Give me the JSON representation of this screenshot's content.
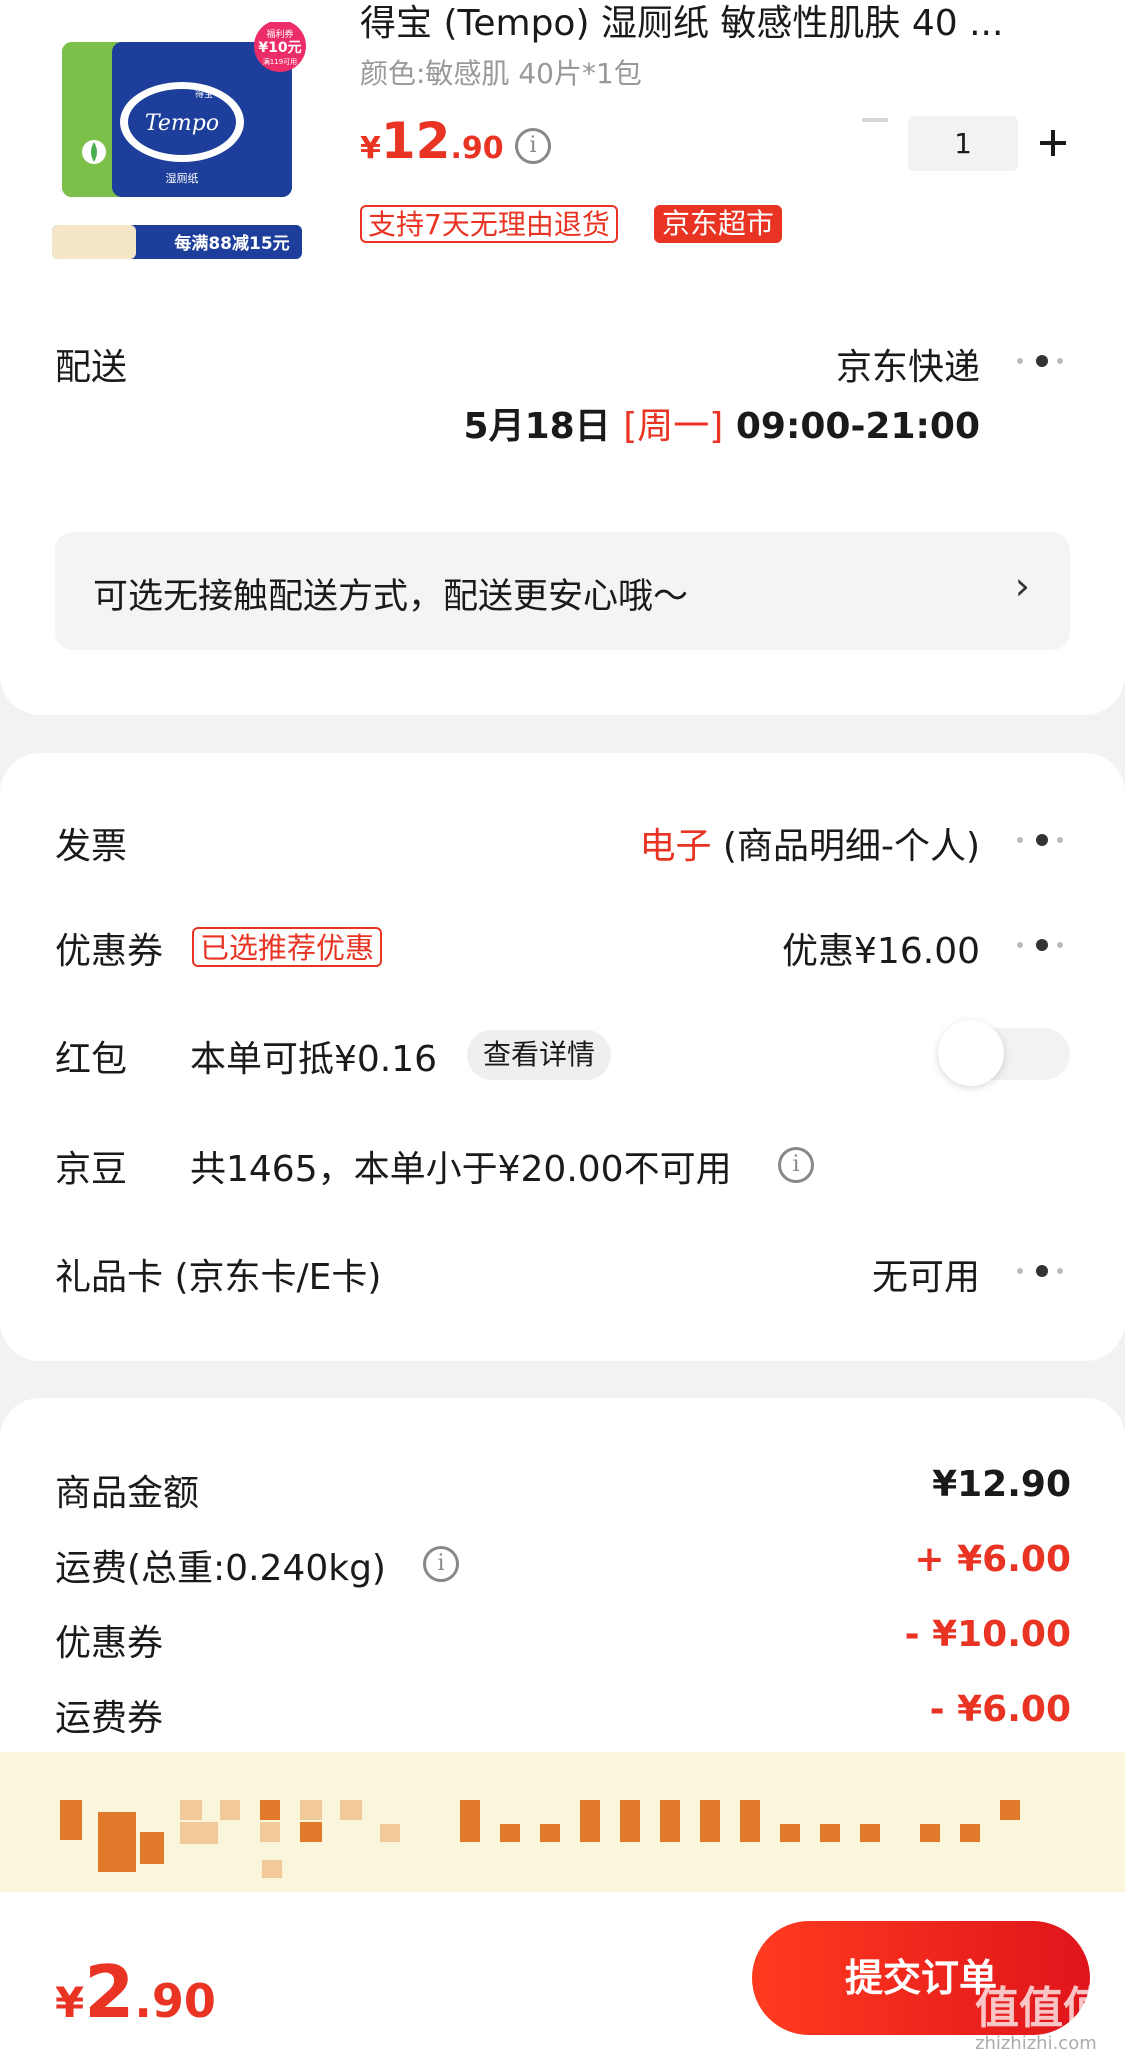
{
  "product": {
    "title": "得宝 (Tempo) 湿厕纸 敏感性肌肤 40 ...",
    "spec": "颜色:敏感肌 40片*1包",
    "price_currency": "¥",
    "price_int": "12",
    "price_dec": ".90",
    "quantity": "1",
    "tag_return": "支持7天无理由退货",
    "tag_store": "京东超市",
    "img_brand": "Tempo",
    "img_brand_cn": "得宝",
    "img_name": "湿厕纸",
    "img_coupon_top": "福利券",
    "img_coupon_amount": "¥10元",
    "img_coupon_cond": "满119可用",
    "img_promo": "每满88减15元"
  },
  "delivery": {
    "label": "配送",
    "method": "京东快递",
    "date": "5月18日",
    "weekday": "[周一]",
    "time": "09:00-21:00",
    "banner": "可选无接触配送方式，配送更安心哦～",
    "banner_chevron": "›"
  },
  "invoice": {
    "label": "发票",
    "type": "电子",
    "detail": "(商品明细-个人)"
  },
  "coupon": {
    "label": "优惠券",
    "badge": "已选推荐优惠",
    "value": "优惠¥16.00"
  },
  "redpacket": {
    "label": "红包",
    "text": "本单可抵¥0.16",
    "link": "查看详情",
    "toggle_on": false
  },
  "jingdou": {
    "label": "京豆",
    "text": "共1465，本单小于¥20.00不可用"
  },
  "giftcard": {
    "label": "礼品卡 (京东卡/E卡)",
    "value": "无可用"
  },
  "summary": {
    "goods_label": "商品金额",
    "goods_value": "¥12.90",
    "freight_label": "运费(总重:0.240kg)",
    "freight_value": "+ ¥6.00",
    "coupon_label": "优惠券",
    "coupon_value": "- ¥10.00",
    "freight_coupon_label": "运费券",
    "freight_coupon_value": "- ¥6.00"
  },
  "footer": {
    "total_currency": "¥",
    "total_int": "2",
    "total_dec": ".90",
    "submit": "提交订单",
    "watermark": "值值值",
    "watermark_sub": "zhizhizhi.com"
  },
  "colors": {
    "accent": "#e93323",
    "notice_bg": "#fbf5dc"
  }
}
